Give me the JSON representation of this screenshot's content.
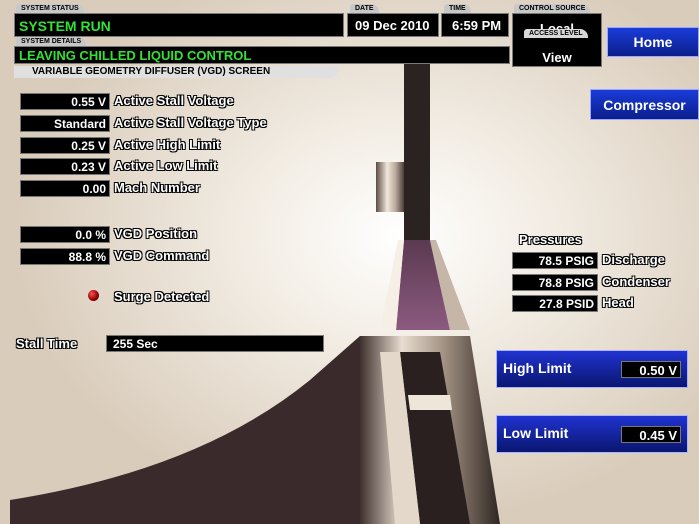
{
  "header": {
    "system_status_tab": "SYSTEM STATUS",
    "system_status": "SYSTEM RUN",
    "system_details_tab": "SYSTEM DETAILS",
    "system_details": "LEAVING CHILLED LIQUID CONTROL",
    "date_tab": "DATE",
    "date": "09 Dec 2010",
    "time_tab": "TIME",
    "time": "6:59 PM",
    "control_source_tab": "CONTROL SOURCE",
    "control_source": "Local",
    "access_level_tab": "ACCESS LEVEL",
    "access_level": "View",
    "screen_title": "VARIABLE GEOMETRY DIFFUSER (VGD) SCREEN"
  },
  "nav": {
    "home": "Home",
    "compressor": "Compressor"
  },
  "params": [
    {
      "value": "0.55 V",
      "label": "Active Stall Voltage"
    },
    {
      "value": "Standard",
      "label": "Active Stall Voltage Type"
    },
    {
      "value": "0.25 V",
      "label": "Active High Limit"
    },
    {
      "value": "0.23 V",
      "label": "Active Low Limit"
    },
    {
      "value": "0.00",
      "label": "Mach Number"
    }
  ],
  "vgd": [
    {
      "value": "0.0 %",
      "label": "VGD Position"
    },
    {
      "value": "88.8 %",
      "label": "VGD Command"
    }
  ],
  "surge": {
    "label": "Surge Detected",
    "indicator_color": "#8b0000"
  },
  "stall_time": {
    "label": "Stall Time",
    "value": "255 Sec"
  },
  "pressures": {
    "title": "Pressures",
    "items": [
      {
        "value": "78.5 PSIG",
        "label": "Discharge"
      },
      {
        "value": "78.8 PSIG",
        "label": "Condenser"
      },
      {
        "value": "27.8 PSID",
        "label": "Head"
      }
    ]
  },
  "high_limit": {
    "label": "High Limit",
    "value": "0.50 V"
  },
  "low_limit": {
    "label": "Low Limit",
    "value": "0.45 V"
  },
  "colors": {
    "status_green": "#33e033",
    "nav_blue": "#1a3cd8"
  }
}
